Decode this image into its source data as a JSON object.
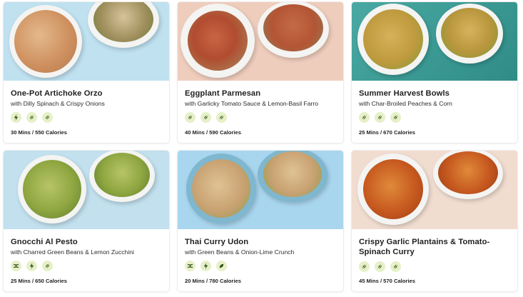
{
  "recipes": [
    {
      "title": "One-Pot Artichoke Orzo",
      "subtitle": "with Dilly Spinach & Crispy Onions",
      "meta": "30 Mins / 550 Calories",
      "tags": [
        "quick-icon",
        "no-meat-icon",
        "vegetarian-icon"
      ],
      "colors": {
        "background": "#bfe1f0",
        "food": "#d9a06a",
        "plate": "#f4f4f2"
      }
    },
    {
      "title": "Eggplant Parmesan",
      "subtitle": "with Garlicky Tomato Sauce & Lemon-Basil Farro",
      "meta": "40 Mins / 590 Calories",
      "tags": [
        "no-meat-icon",
        "vegetarian-icon",
        "vegetarian-icon"
      ],
      "colors": {
        "background": "#efcdbd",
        "food": "#b9573a",
        "plate": "#f4f4f2"
      }
    },
    {
      "title": "Summer Harvest Bowls",
      "subtitle": "with Char-Broiled Peaches & Corn",
      "meta": "25 Mins / 670 Calories",
      "tags": [
        "no-meat-icon",
        "vegetarian-icon",
        "vegetarian-icon"
      ],
      "colors": {
        "background": "#3d9f9a",
        "food": "#c9a043",
        "plate": "#f4f4f2"
      }
    },
    {
      "title": "Gnocchi Al Pesto",
      "subtitle": "with Charred Green Beans & Lemon Zucchini",
      "meta": "25 Mins / 650 Calories",
      "tags": [
        "shuffle-icon",
        "quick-icon",
        "vegetarian-icon"
      ],
      "colors": {
        "background": "#c2e0ee",
        "food": "#8ea640",
        "plate": "#f4f4f2"
      }
    },
    {
      "title": "Thai Curry Udon",
      "subtitle": "with Green Beans & Onion-Lime Crunch",
      "meta": "20 Mins / 780 Calories",
      "tags": [
        "shuffle-icon",
        "quick-icon",
        "leaf-icon"
      ],
      "colors": {
        "background": "#a9d6ef",
        "food": "#c9a273",
        "plate": "#f4f4f2"
      }
    },
    {
      "title": "Crispy Garlic Plantains & Tomato-Spinach Curry",
      "subtitle": "",
      "meta": "45 Mins / 570 Calories",
      "tags": [
        "no-meat-icon",
        "vegetarian-icon",
        "vegetarian-icon"
      ],
      "colors": {
        "background": "#f1ddd0",
        "food": "#c6591f",
        "plate": "#f4f4f2"
      }
    }
  ]
}
